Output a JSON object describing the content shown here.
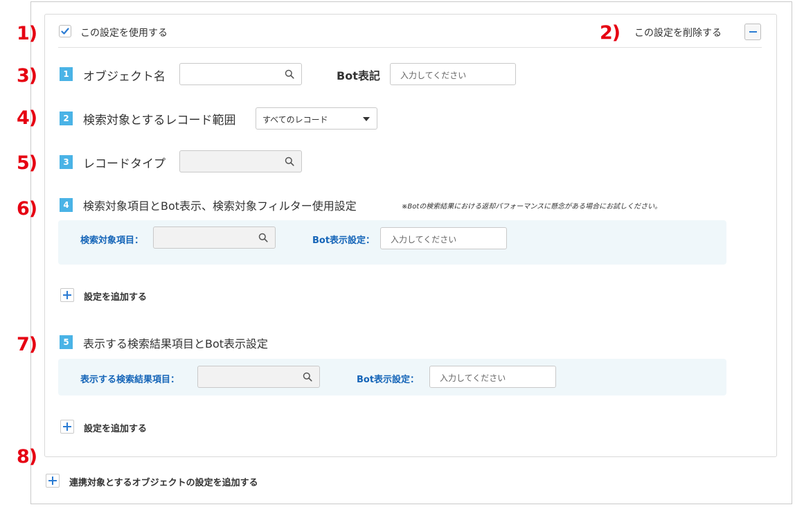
{
  "markers": [
    "1)",
    "2)",
    "3)",
    "4)",
    "5)",
    "6)",
    "7)",
    "8)"
  ],
  "header": {
    "use_setting_label": "この設定を使用する",
    "use_setting_checked": true,
    "delete_setting_label": "この設定を削除する"
  },
  "steps": [
    {
      "number": "1",
      "title": "オブジェクト名",
      "bot_label": "Bot表記",
      "bot_placeholder": "入力してください"
    },
    {
      "number": "2",
      "title": "検索対象とするレコード範囲",
      "select_value": "すべてのレコード"
    },
    {
      "number": "3",
      "title": "レコードタイプ"
    },
    {
      "number": "4",
      "title": "検索対象項目とBot表示、検索対象フィルター使用設定",
      "note": "※Botの検索結果における返却パフォーマンスに懸念がある場合にお試しください。",
      "field_label": "検索対象項目：",
      "bot_field_label": "Bot表示設定：",
      "bot_placeholder": "入力してください",
      "add_label": "設定を追加する"
    },
    {
      "number": "5",
      "title": "表示する検索結果項目とBot表示設定",
      "field_label": "表示する検索結果項目：",
      "bot_field_label": "Bot表示設定：",
      "bot_placeholder": "入力してください",
      "add_label": "設定を追加する"
    }
  ],
  "footer": {
    "add_object_label": "連携対象とするオブジェクトの設定を追加する"
  },
  "icons": {
    "search": "search-icon",
    "check": "checkmark-icon",
    "minus": "minus-icon",
    "plus": "plus-icon",
    "dropdown": "caret-down-icon"
  },
  "colors": {
    "marker": "#e60012",
    "step_badge": "#4ab3e6",
    "field_label": "#1565b8",
    "accent": "#2a7bd3",
    "subpanel_bg": "#eff7fa"
  }
}
